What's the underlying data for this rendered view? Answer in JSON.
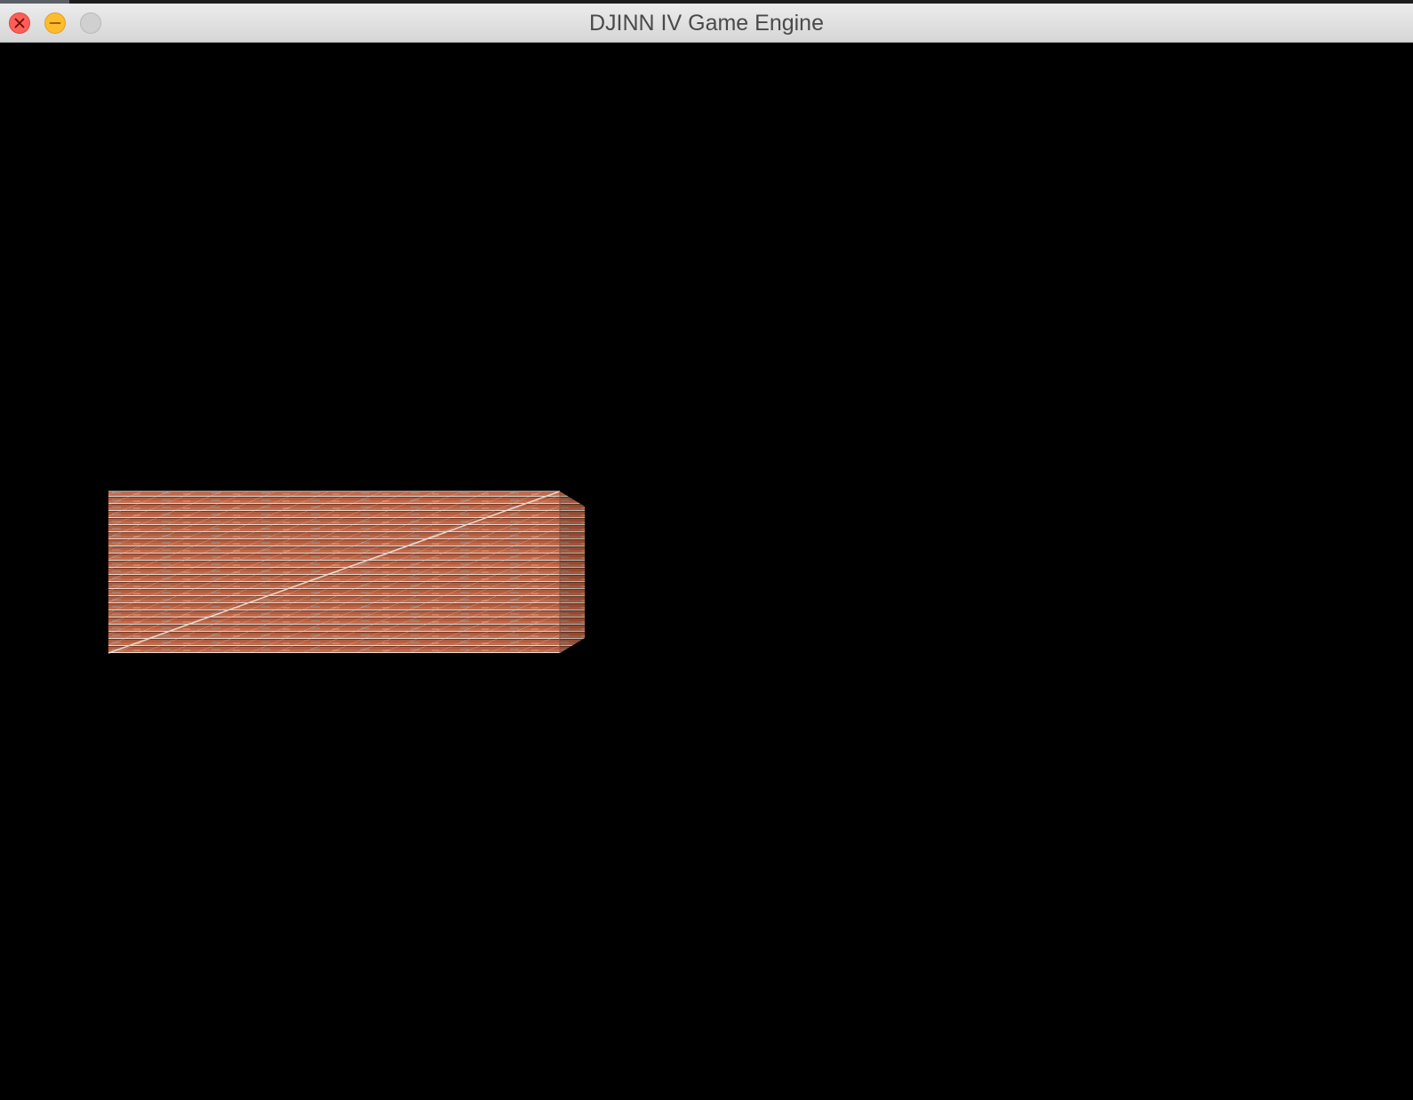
{
  "window": {
    "title": "DJINN IV Game Engine"
  },
  "titlebar_buttons": {
    "close": "close-icon",
    "minimize": "minimize-icon",
    "zoom": "zoom-icon"
  },
  "scene": {
    "background_color": "#000000",
    "object": "brick-textured-box",
    "texture_color": "#c8704f"
  }
}
